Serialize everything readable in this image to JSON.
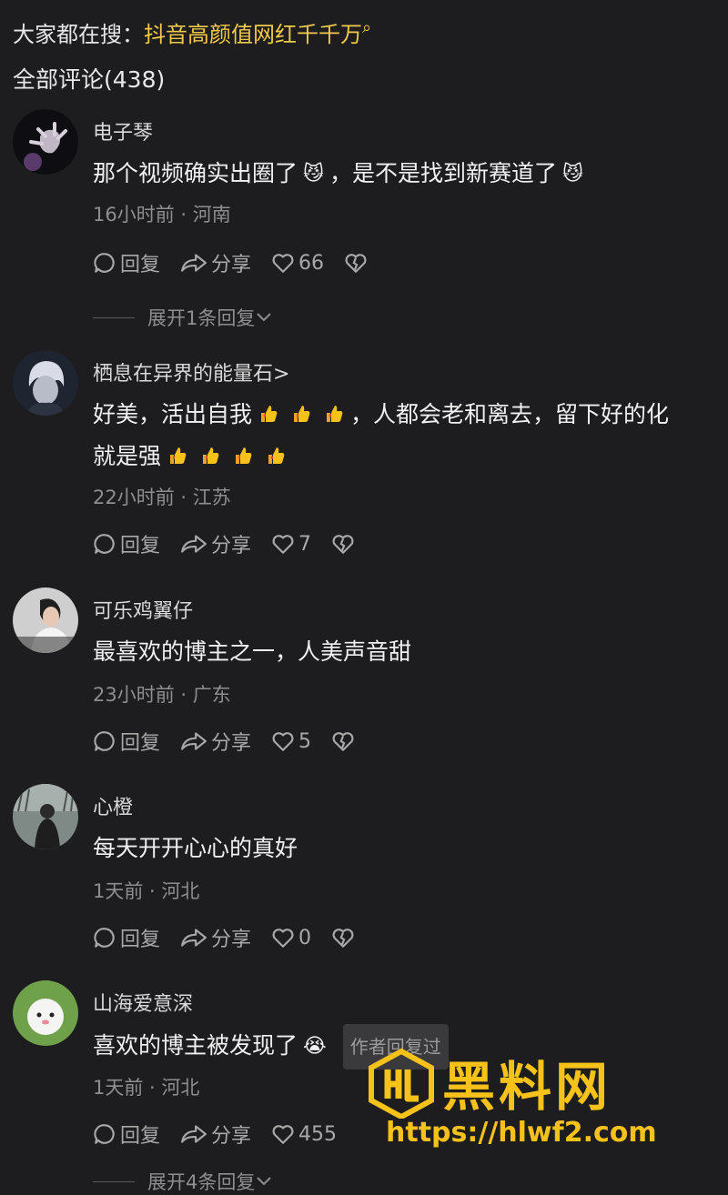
{
  "header": {
    "search_prefix": "大家都在搜：",
    "search_hot": "抖音高颜值网红千千万",
    "comment_count": "全部评论(438)"
  },
  "comments": [
    {
      "username": "电子琴",
      "text_a": "那个视频确实出圈了",
      "emoji_a": "😼",
      "text_b": "，是不是找到新赛道了",
      "emoji_b": "😼",
      "meta": "16小时前 · 河南",
      "reply_label": "回复",
      "share_label": "分享",
      "likes": "66",
      "expand": "展开1条回复"
    },
    {
      "username": "栖息在异界的能量石>",
      "text_a": "好美，活出自我",
      "text_b": "，人都会老和离去，留下好的化",
      "text_c": "就是强",
      "meta": "22小时前 · 江苏",
      "reply_label": "回复",
      "share_label": "分享",
      "likes": "7"
    },
    {
      "username": "可乐鸡翼仔",
      "text_a": "最喜欢的博主之一，人美声音甜",
      "meta": "23小时前 · 广东",
      "reply_label": "回复",
      "share_label": "分享",
      "likes": "5"
    },
    {
      "username": "心橙",
      "text_a": "每天开开心心的真好",
      "meta": "1天前 · 河北",
      "reply_label": "回复",
      "share_label": "分享",
      "likes": "0"
    },
    {
      "username": "山海爱意深",
      "text_a": "喜欢的博主被发现了",
      "emoji_a": "😭",
      "author_tag": "作者回复过",
      "meta": "1天前 · 河北",
      "reply_label": "回复",
      "share_label": "分享",
      "likes": "455",
      "expand": "展开4条回复"
    }
  ],
  "watermark": {
    "title": "黑料网",
    "url": "https://hlwf2.com"
  },
  "colors": {
    "background": "#1d1d1f",
    "accent": "#f1c94a",
    "watermark": "#f6c21a"
  }
}
